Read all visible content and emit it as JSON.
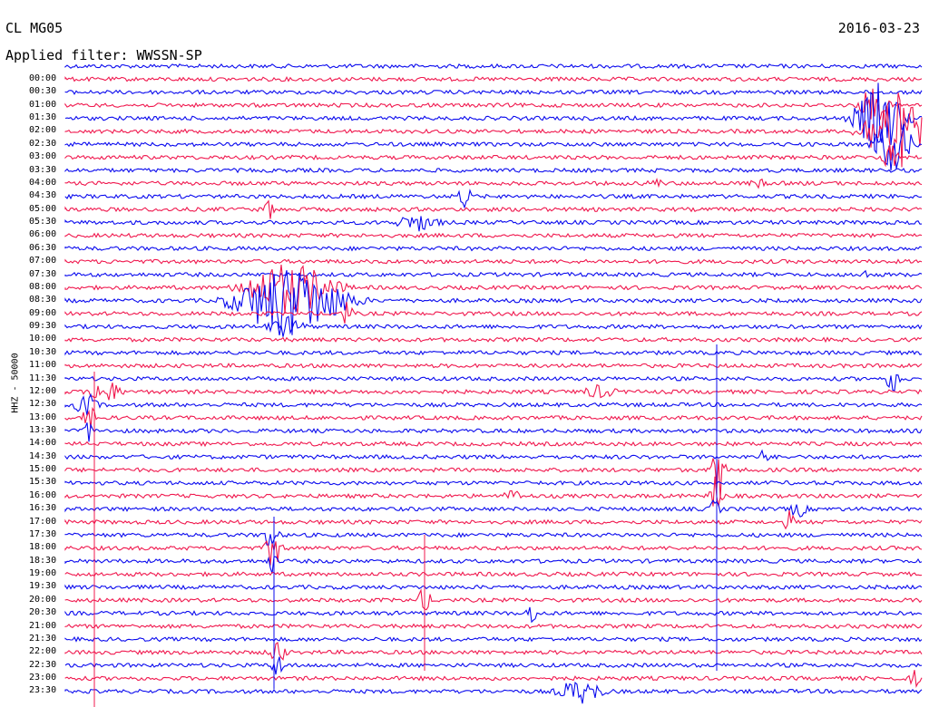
{
  "header": {
    "station": "CL MG05",
    "date": "2016-03-23",
    "filter": "Applied filter: WWSSN-SP"
  },
  "axis": {
    "ylabel": "HHZ - 50000"
  },
  "colors": {
    "trace_a": "#0a0aee",
    "trace_b": "#f0184e"
  },
  "time_labels": [
    "00:00",
    "00:30",
    "01:00",
    "01:30",
    "02:00",
    "02:30",
    "03:00",
    "03:30",
    "04:00",
    "04:30",
    "05:00",
    "05:30",
    "06:00",
    "06:30",
    "07:00",
    "07:30",
    "08:00",
    "08:30",
    "09:00",
    "09:30",
    "10:00",
    "10:30",
    "11:00",
    "11:30",
    "12:00",
    "12:30",
    "13:00",
    "13:30",
    "14:00",
    "14:30",
    "15:00",
    "15:30",
    "16:00",
    "16:30",
    "17:00",
    "17:30",
    "18:00",
    "18:30",
    "19:00",
    "19:30",
    "20:00",
    "20:30",
    "21:00",
    "21:30",
    "22:00",
    "22:30",
    "23:00",
    "23:30"
  ]
}
